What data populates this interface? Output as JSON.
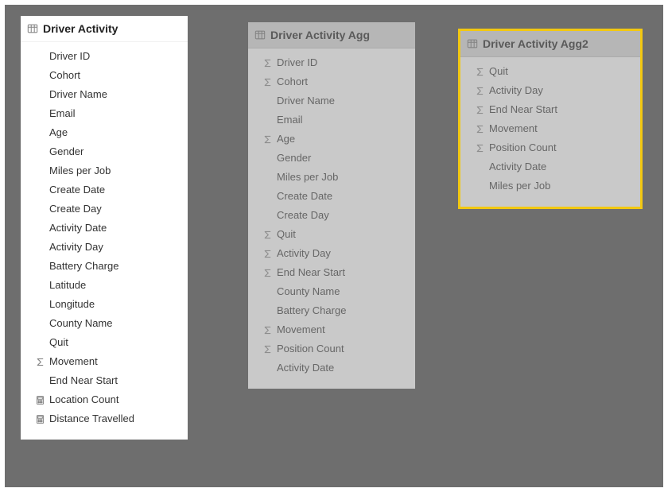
{
  "tables": [
    {
      "id": "card1",
      "title": "Driver Activity",
      "dimmed": false,
      "selected": false,
      "fields": [
        {
          "icon": "none",
          "label": "Driver ID"
        },
        {
          "icon": "none",
          "label": "Cohort"
        },
        {
          "icon": "none",
          "label": "Driver Name"
        },
        {
          "icon": "none",
          "label": "Email"
        },
        {
          "icon": "none",
          "label": "Age"
        },
        {
          "icon": "none",
          "label": "Gender"
        },
        {
          "icon": "none",
          "label": "Miles per Job"
        },
        {
          "icon": "none",
          "label": "Create Date"
        },
        {
          "icon": "none",
          "label": "Create Day"
        },
        {
          "icon": "none",
          "label": "Activity Date"
        },
        {
          "icon": "none",
          "label": "Activity Day"
        },
        {
          "icon": "none",
          "label": "Battery Charge"
        },
        {
          "icon": "none",
          "label": "Latitude"
        },
        {
          "icon": "none",
          "label": "Longitude"
        },
        {
          "icon": "none",
          "label": "County Name"
        },
        {
          "icon": "none",
          "label": "Quit"
        },
        {
          "icon": "sigma",
          "label": "Movement"
        },
        {
          "icon": "none",
          "label": "End Near Start"
        },
        {
          "icon": "calc",
          "label": "Location Count"
        },
        {
          "icon": "calc",
          "label": "Distance Travelled"
        }
      ]
    },
    {
      "id": "card2",
      "title": "Driver Activity Agg",
      "dimmed": true,
      "selected": false,
      "fields": [
        {
          "icon": "sigma",
          "label": "Driver ID"
        },
        {
          "icon": "sigma",
          "label": "Cohort"
        },
        {
          "icon": "none",
          "label": "Driver Name"
        },
        {
          "icon": "none",
          "label": "Email"
        },
        {
          "icon": "sigma",
          "label": "Age"
        },
        {
          "icon": "none",
          "label": "Gender"
        },
        {
          "icon": "none",
          "label": "Miles per Job"
        },
        {
          "icon": "none",
          "label": "Create Date"
        },
        {
          "icon": "none",
          "label": "Create Day"
        },
        {
          "icon": "sigma",
          "label": "Quit"
        },
        {
          "icon": "sigma",
          "label": "Activity Day"
        },
        {
          "icon": "sigma",
          "label": "End Near Start"
        },
        {
          "icon": "none",
          "label": "County Name"
        },
        {
          "icon": "none",
          "label": "Battery Charge"
        },
        {
          "icon": "sigma",
          "label": "Movement"
        },
        {
          "icon": "sigma",
          "label": "Position Count"
        },
        {
          "icon": "none",
          "label": "Activity Date"
        }
      ]
    },
    {
      "id": "card3",
      "title": "Driver Activity Agg2",
      "dimmed": true,
      "selected": true,
      "fields": [
        {
          "icon": "sigma",
          "label": "Quit"
        },
        {
          "icon": "sigma",
          "label": "Activity Day"
        },
        {
          "icon": "sigma",
          "label": "End Near Start"
        },
        {
          "icon": "sigma",
          "label": "Movement"
        },
        {
          "icon": "sigma",
          "label": "Position Count"
        },
        {
          "icon": "none",
          "label": "Activity Date"
        },
        {
          "icon": "none",
          "label": "Miles per Job"
        }
      ]
    }
  ]
}
